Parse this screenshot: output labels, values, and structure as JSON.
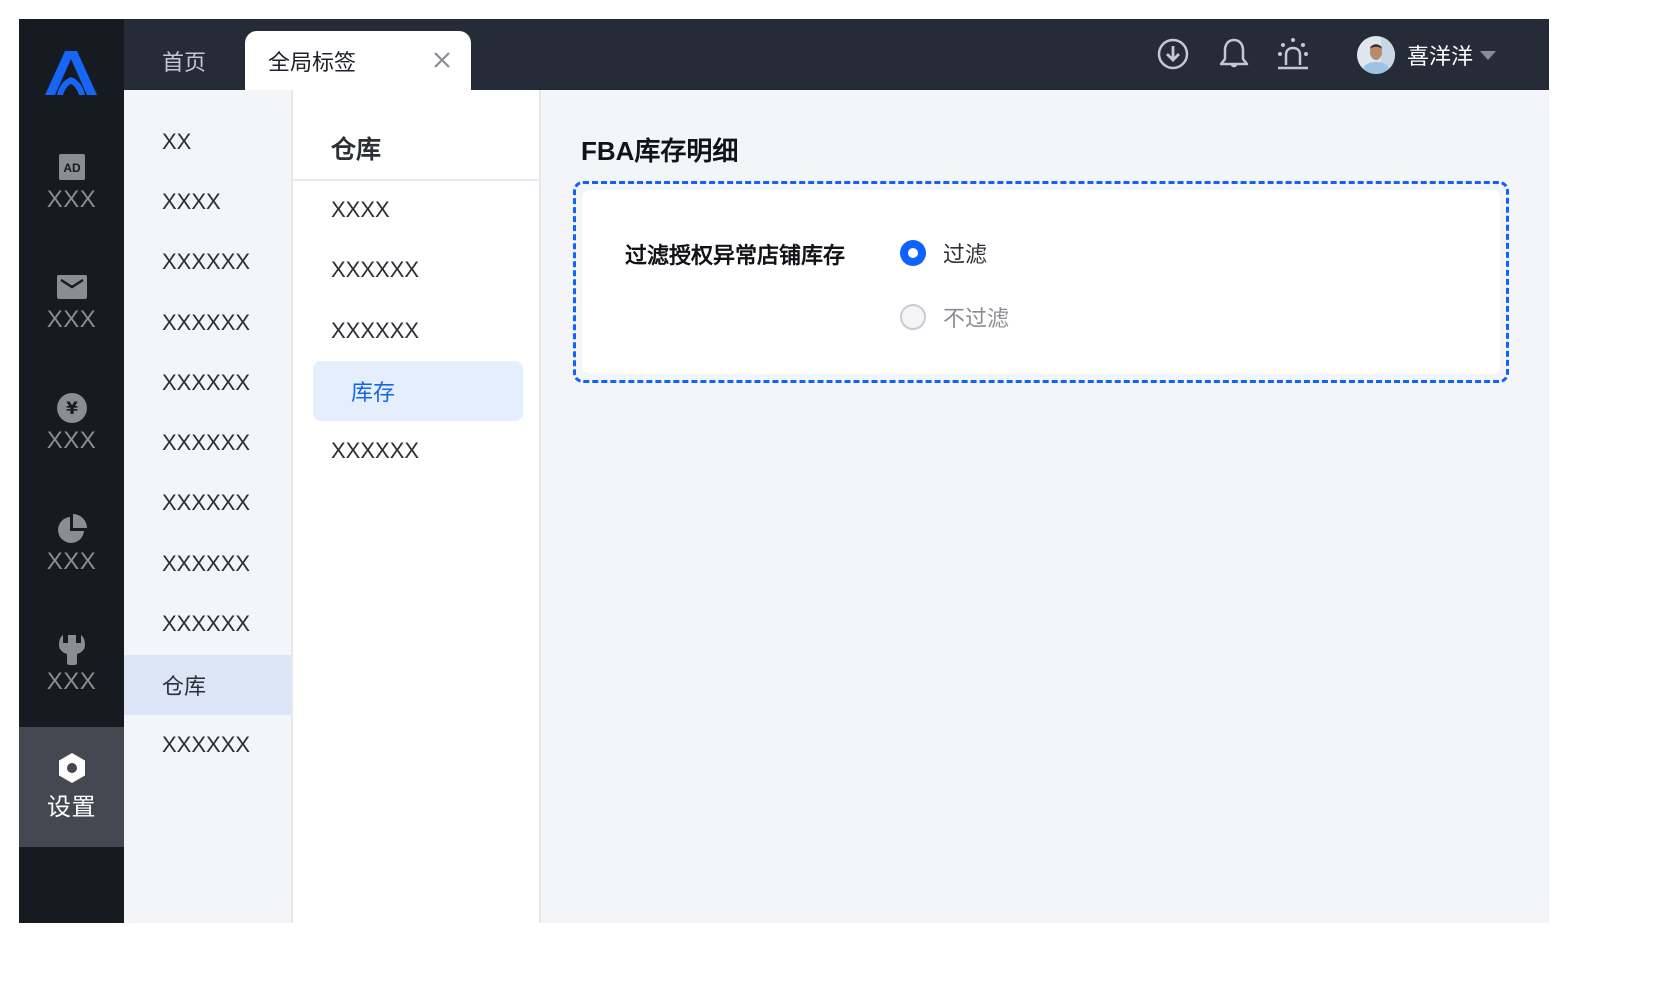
{
  "rail": {
    "items": [
      {
        "icon": "ad-icon",
        "label": "XXX"
      },
      {
        "icon": "mail-icon",
        "label": "XXX"
      },
      {
        "icon": "yuan-icon",
        "label": "XXX"
      },
      {
        "icon": "pie-chart-icon",
        "label": "XXX"
      },
      {
        "icon": "wrench-icon",
        "label": "XXX"
      },
      {
        "icon": "settings-hex-icon",
        "label": "设置",
        "active": true
      }
    ]
  },
  "topbar": {
    "tabs": [
      {
        "label": "首页"
      },
      {
        "label": "全局标签",
        "active": true,
        "close_icon": "close-icon"
      }
    ],
    "icons": [
      "download-icon",
      "bell-icon",
      "alarm-light-icon"
    ],
    "user": {
      "name": "喜洋洋"
    }
  },
  "subnav": {
    "items": [
      "XX",
      "XXXX",
      "XXXXXX",
      "XXXXXX",
      "XXXXXX",
      "XXXXXX",
      "XXXXXX",
      "XXXXXX",
      "XXXXXX",
      "仓库",
      "XXXXXX"
    ],
    "active_index": 9
  },
  "thirdnav": {
    "title": "仓库",
    "items": [
      "XXXX",
      "XXXXXX",
      "XXXXXX",
      "库存",
      "XXXXXX"
    ],
    "active_index": 3
  },
  "main": {
    "title": "FBA库存明细",
    "field": {
      "label": "过滤授权异常店铺库存",
      "options": [
        {
          "label": "过滤",
          "checked": true
        },
        {
          "label": "不过滤",
          "checked": false
        }
      ]
    }
  },
  "colors": {
    "accent": "#0f62fe",
    "rail_bg": "#161a21",
    "topbar_bg": "#252b37",
    "active_rail": "#454850",
    "page_bg": "#f4f5f9"
  }
}
